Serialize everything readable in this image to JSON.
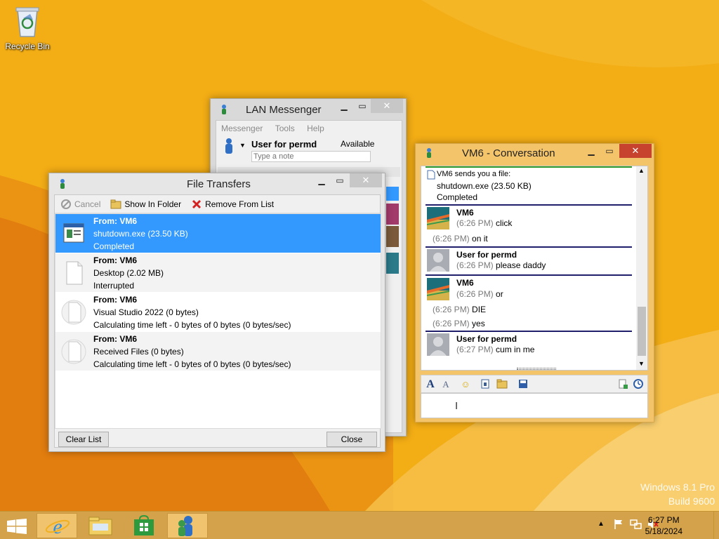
{
  "desktop": {
    "recycle_bin_label": "Recycle Bin"
  },
  "watermark": {
    "line1": "Windows 8.1 Pro",
    "line2": "Build 9600"
  },
  "lan_messenger": {
    "title": "LAN Messenger",
    "menu": [
      "Messenger",
      "Tools",
      "Help"
    ],
    "user_name": "User for permd",
    "status": "Available",
    "note_placeholder": "Type a note"
  },
  "file_transfers": {
    "title": "File Transfers",
    "toolbar": {
      "cancel": "Cancel",
      "show_in_folder": "Show In Folder",
      "remove_from_list": "Remove From List"
    },
    "items": [
      {
        "from": "From: VM6",
        "file": "shutdown.exe (23.50 KB)",
        "status": "Completed",
        "icon": "exe-file-icon"
      },
      {
        "from": "From: VM6",
        "file": "Desktop (2.02 MB)",
        "status": "Interrupted",
        "icon": "blank-file-icon"
      },
      {
        "from": "From: VM6",
        "file": "Visual Studio 2022 (0 bytes)",
        "status": "Calculating time left - 0 bytes of 0 bytes (0 bytes/sec)",
        "icon": "progress-file-icon"
      },
      {
        "from": "From: VM6",
        "file": "Received Files (0 bytes)",
        "status": "Calculating time left - 0 bytes of 0 bytes (0 bytes/sec)",
        "icon": "progress-file-icon"
      }
    ],
    "clear_list": "Clear List",
    "close": "Close"
  },
  "conversation": {
    "title": "VM6 - Conversation",
    "file_notice": {
      "line1": "VM6 sends you a file:",
      "line2": "shutdown.exe (23.50 KB)",
      "line3": "Completed"
    },
    "messages": [
      {
        "sender": "VM6",
        "lines": [
          {
            "ts": "(6:26 PM)",
            "text": "click"
          },
          {
            "ts": "(6:26 PM)",
            "text": "on it"
          }
        ]
      },
      {
        "sender": "User for permd",
        "lines": [
          {
            "ts": "(6:26 PM)",
            "text": "please daddy"
          }
        ]
      },
      {
        "sender": "VM6",
        "lines": [
          {
            "ts": "(6:26 PM)",
            "text": "or"
          },
          {
            "ts": "(6:26 PM)",
            "text": "DIE"
          },
          {
            "ts": "(6:26 PM)",
            "text": "yes"
          }
        ]
      },
      {
        "sender": "User for permd",
        "lines": [
          {
            "ts": "(6:27 PM)",
            "text": "cum in me"
          }
        ]
      }
    ]
  },
  "taskbar": {
    "time": "6:27 PM",
    "date": "5/18/2024"
  },
  "colors": {
    "selection": "#3399ff",
    "close_red": "#c7432e",
    "separator_navy": "#1f1f6b",
    "accent_green": "#2e9a2e"
  }
}
